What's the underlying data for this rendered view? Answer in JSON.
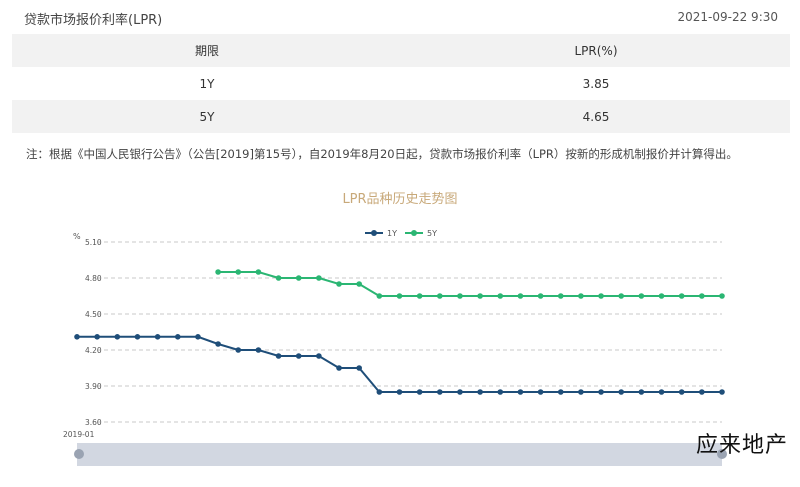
{
  "header": {
    "title": "贷款市场报价利率(LPR)",
    "timestamp": "2021-09-22 9:30"
  },
  "table": {
    "headers": [
      "期限",
      "LPR(%)"
    ],
    "rows": [
      {
        "term": "1Y",
        "rate": "3.85"
      },
      {
        "term": "5Y",
        "rate": "4.65"
      }
    ]
  },
  "note": "注：根据《中国人民银行公告》（公告[2019]第15号），自2019年8月20日起，贷款市场报价利率（LPR）按新的形成机制报价并计算得出。",
  "watermark": "应来地产",
  "colors": {
    "series_1y": "#1f4e79",
    "series_5y": "#2bb673",
    "title": "#c8a97a"
  },
  "chart_data": {
    "type": "line",
    "title": "LPR品种历史走势图",
    "ylabel": "%",
    "ylim": [
      3.6,
      5.1
    ],
    "yticks": [
      "5.10",
      "4.80",
      "4.50",
      "4.20",
      "3.90",
      "3.60"
    ],
    "x_start_label": "2019-01",
    "legend": "top-center",
    "grid": "horizontal-dashed",
    "series": [
      {
        "name": "1Y",
        "color": "#1f4e79",
        "values": [
          4.31,
          4.31,
          4.31,
          4.31,
          4.31,
          4.31,
          4.31,
          4.25,
          4.2,
          4.2,
          4.15,
          4.15,
          4.15,
          4.05,
          4.05,
          3.85,
          3.85,
          3.85,
          3.85,
          3.85,
          3.85,
          3.85,
          3.85,
          3.85,
          3.85,
          3.85,
          3.85,
          3.85,
          3.85,
          3.85,
          3.85,
          3.85,
          3.85
        ]
      },
      {
        "name": "5Y",
        "color": "#2bb673",
        "values": [
          null,
          null,
          null,
          null,
          null,
          null,
          null,
          4.85,
          4.85,
          4.85,
          4.8,
          4.8,
          4.8,
          4.75,
          4.75,
          4.65,
          4.65,
          4.65,
          4.65,
          4.65,
          4.65,
          4.65,
          4.65,
          4.65,
          4.65,
          4.65,
          4.65,
          4.65,
          4.65,
          4.65,
          4.65,
          4.65,
          4.65
        ]
      }
    ]
  }
}
